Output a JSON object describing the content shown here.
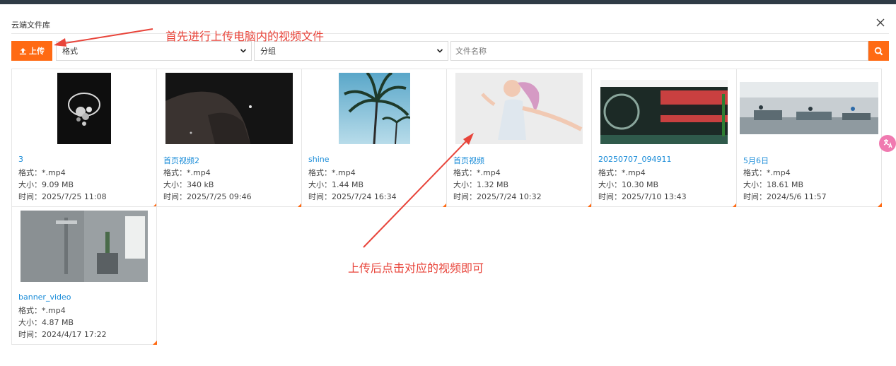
{
  "dialog": {
    "title": "云端文件库",
    "close_icon": "close-icon"
  },
  "toolbar": {
    "upload_label": "上传",
    "upload_icon": "upload-icon",
    "format_select": "格式",
    "group_select": "分组",
    "search_placeholder": "文件名称",
    "search_icon": "search-icon"
  },
  "files": [
    {
      "name": "3",
      "format": "格式：*.mp4",
      "size": "大小：9.09 MB",
      "time": "时间：2025/7/25 11:08"
    },
    {
      "name": "首页视频2",
      "format": "格式：*.mp4",
      "size": "大小：340 kB",
      "time": "时间：2025/7/25 09:46"
    },
    {
      "name": "shine",
      "format": "格式：*.mp4",
      "size": "大小：1.44 MB",
      "time": "时间：2025/7/24 16:34"
    },
    {
      "name": "首页视频",
      "format": "格式：*.mp4",
      "size": "大小：1.32 MB",
      "time": "时间：2025/7/24 10:32"
    },
    {
      "name": "20250707_094911",
      "format": "格式：*.mp4",
      "size": "大小：10.30 MB",
      "time": "时间：2025/7/10 13:43"
    },
    {
      "name": "5月6日",
      "format": "格式：*.mp4",
      "size": "大小：18.61 MB",
      "time": "时间：2024/5/6 11:57"
    },
    {
      "name": "banner_video",
      "format": "格式：*.mp4",
      "size": "大小：4.87 MB",
      "time": "时间：2024/4/17 17:22"
    }
  ],
  "annotations": {
    "upload_hint": "首先进行上传电脑内的视频文件",
    "click_hint": "上传后点击对应的视频即可"
  },
  "colors": {
    "accent": "#ff6a13",
    "link": "#1a8cd8",
    "annotation": "#e8443a"
  }
}
